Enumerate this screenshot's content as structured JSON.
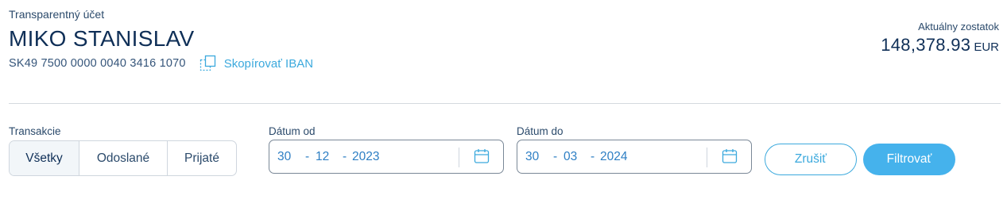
{
  "account": {
    "type_label": "Transparentný účet",
    "name": "MIKO STANISLAV",
    "iban": "SK49 7500 0000 0040 3416 1070",
    "copy_iban_label": "Skopírovať IBAN"
  },
  "balance": {
    "label": "Aktuálny zostatok",
    "amount": "148,378.93",
    "currency": "EUR"
  },
  "filters": {
    "transactions_label": "Transakcie",
    "transaction_types": [
      "Všetky",
      "Odoslané",
      "Prijaté"
    ],
    "active_type": "Všetky",
    "date_from": {
      "label": "Dátum od",
      "day": "30",
      "month": "12",
      "year": "2023"
    },
    "date_to": {
      "label": "Dátum do",
      "day": "30",
      "month": "03",
      "year": "2024"
    },
    "cancel_label": "Zrušiť",
    "filter_label": "Filtrovať"
  },
  "colors": {
    "accent": "#45b2ec",
    "link": "#3ba9dd",
    "text_primary": "#0f2f57",
    "date_text": "#2e7fc4"
  },
  "icons": {
    "copy": "copy-icon",
    "calendar": "calendar-icon"
  }
}
